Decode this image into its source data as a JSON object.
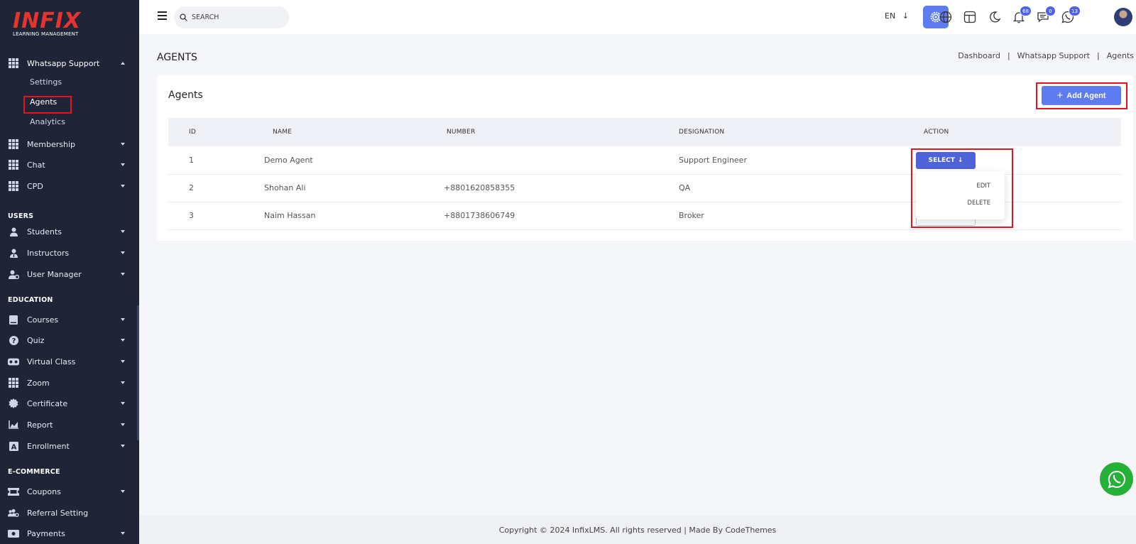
{
  "brand": {
    "name": "INFIX",
    "tagline": "LEARNING MANAGEMENT"
  },
  "sidebar": {
    "whatsapp": {
      "label": "Whatsapp Support",
      "children": [
        "Settings",
        "Agents",
        "Analytics"
      ]
    },
    "items_top": [
      "Membership",
      "Chat",
      "CPD"
    ],
    "users_title": "USERS",
    "users": [
      "Students",
      "Instructors",
      "User Manager"
    ],
    "education_title": "EDUCATION",
    "education": [
      "Courses",
      "Quiz",
      "Virtual Class",
      "Zoom",
      "Certificate",
      "Report",
      "Enrollment"
    ],
    "ecommerce_title": "E-COMMERCE",
    "ecommerce": [
      "Coupons",
      "Referral Setting",
      "Payments"
    ]
  },
  "topbar": {
    "search_placeholder": "SEARCH",
    "language": "EN",
    "notifications_count": "68",
    "messages_count": "0",
    "whatsapp_count": "13"
  },
  "page": {
    "title": "AGENTS",
    "breadcrumb": [
      "Dashboard",
      "Whatsapp Support",
      "Agents"
    ]
  },
  "card": {
    "title": "Agents",
    "add_button": "Add Agent",
    "columns": [
      "ID",
      "NAME",
      "NUMBER",
      "DESIGNATION",
      "ACTION"
    ],
    "rows": [
      {
        "id": "1",
        "name": "Demo Agent",
        "number": "",
        "designation": "Support Engineer"
      },
      {
        "id": "2",
        "name": "Shohan Ali",
        "number": "+8801620858355",
        "designation": "QA"
      },
      {
        "id": "3",
        "name": "Naim Hassan",
        "number": "+8801738606749",
        "designation": "Broker"
      }
    ],
    "select_label": "SELECT",
    "dropdown": [
      "EDIT",
      "DELETE"
    ]
  },
  "footer": {
    "text": "Copyright © 2024 InfixLMS. All rights reserved | Made By CodeThemes"
  },
  "colors": {
    "sidebar_bg": "#1f2436",
    "accent": "#5e7bf0",
    "highlight": "#e8121e",
    "whatsapp": "#25b138"
  }
}
